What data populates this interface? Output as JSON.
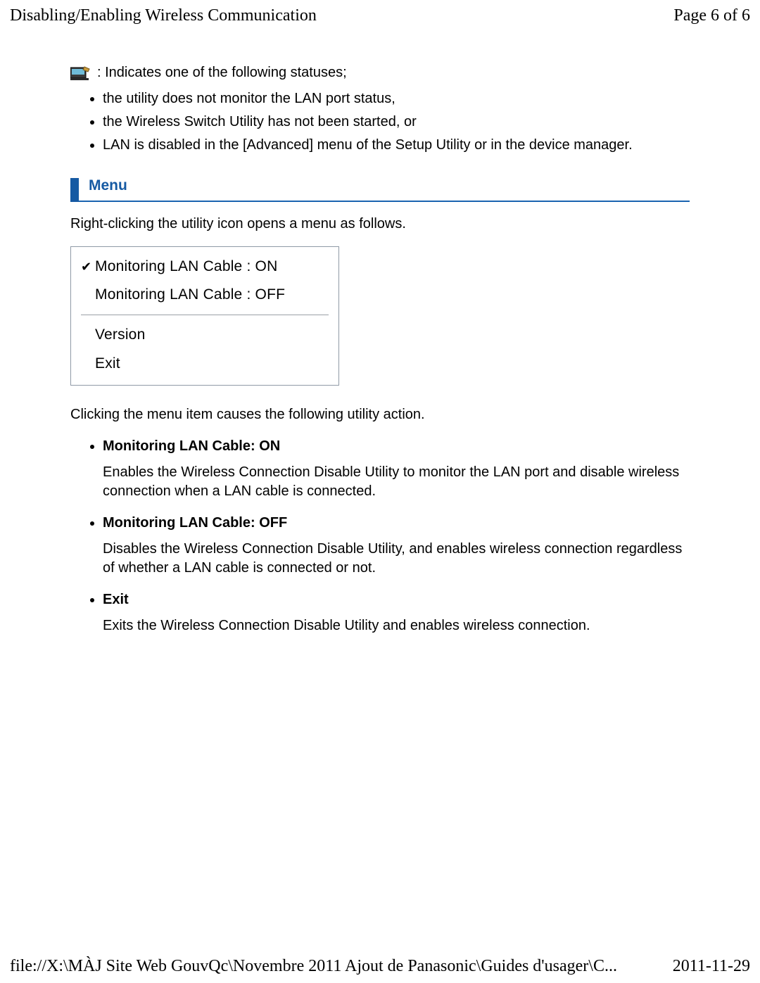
{
  "header": {
    "title": "Disabling/Enabling Wireless Communication",
    "page": "Page 6 of 6"
  },
  "icon_line": " : Indicates one of the following statuses;",
  "status_bullets": [
    "the utility does not monitor the LAN port status,",
    "the Wireless Switch Utility has not been started, or",
    "LAN is disabled in the [Advanced] menu of the Setup Utility or in the device manager."
  ],
  "section_menu": "Menu",
  "menu_intro": "Right-clicking the utility icon opens a menu as follows.",
  "menu_items": [
    {
      "checked": true,
      "label": "Monitoring LAN Cable : ON"
    },
    {
      "checked": false,
      "label": "Monitoring LAN Cable : OFF"
    },
    {
      "sep": true
    },
    {
      "checked": false,
      "label": "Version"
    },
    {
      "checked": false,
      "label": "Exit"
    }
  ],
  "actions_intro": "Clicking the menu item causes the following utility action.",
  "actions": [
    {
      "title": "Monitoring LAN Cable: ON",
      "body": "Enables the Wireless Connection Disable Utility to monitor the LAN port and disable wireless connection when a LAN cable is connected."
    },
    {
      "title": "Monitoring LAN Cable: OFF",
      "body": "Disables the Wireless Connection Disable Utility, and enables wireless connection regardless of whether a LAN cable is connected or not."
    },
    {
      "title": "Exit",
      "body": "Exits the Wireless Connection Disable Utility and enables wireless connection."
    }
  ],
  "footer": {
    "path": "file://X:\\MÀJ Site Web GouvQc\\Novembre 2011 Ajout de Panasonic\\Guides d'usager\\C...",
    "date": "2011-11-29"
  },
  "icon_name": "network-tray-icon"
}
